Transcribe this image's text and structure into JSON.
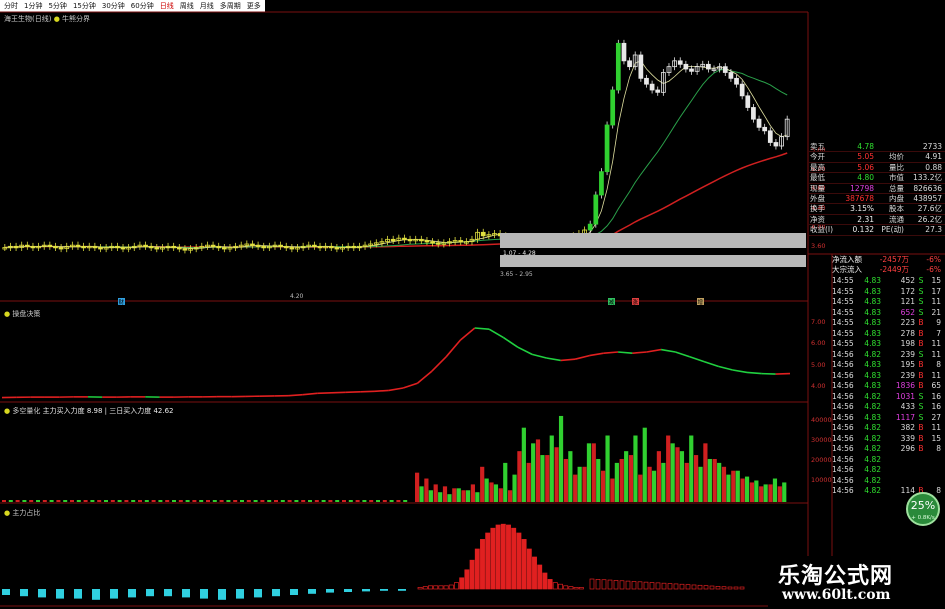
{
  "tabs": [
    "分时",
    "1分钟",
    "5分钟",
    "15分钟",
    "30分钟",
    "60分钟",
    "日线",
    "周线",
    "月线",
    "多周期",
    "更多"
  ],
  "active_tab": "日线",
  "panes": {
    "main_title": "海王生物(日线)",
    "main_indicator": "牛熊分界",
    "p2_title": "操盘决策",
    "p3_title": "多空量化",
    "p3_l1": "主力买入力度",
    "p3_v1": "8.98",
    "p3_l2": "三日买入力度",
    "p3_v2": "42.62",
    "p4_title": "主力占比"
  },
  "quote": [
    {
      "k": "卖五",
      "v": "4.78",
      "vc": "grn",
      "k2": "",
      "v2": "2733"
    },
    {
      "k": "今开",
      "v": "5.05",
      "vc": "red",
      "k2": "均价",
      "v2": "4.91"
    },
    {
      "k": "最高",
      "v": "5.06",
      "vc": "red",
      "k2": "量比",
      "v2": "0.88"
    },
    {
      "k": "最低",
      "v": "4.80",
      "vc": "grn",
      "k2": "市值",
      "v2": "133.2亿"
    },
    {
      "k": "现量",
      "v": "12798",
      "vc": "mag",
      "k2": "总量",
      "v2": "826636"
    },
    {
      "k": "外盘",
      "v": "387678",
      "vc": "red",
      "k2": "内盘",
      "v2": "438957"
    },
    {
      "k": "换手",
      "v": "3.15%",
      "vc": "wht",
      "k2": "股本",
      "v2": "27.6亿"
    },
    {
      "k": "净资",
      "v": "2.31",
      "vc": "wht",
      "k2": "流通",
      "v2": "26.2亿"
    },
    {
      "k": "收益(I)",
      "v": "0.132",
      "vc": "wht",
      "k2": "PE(动)",
      "v2": "27.3"
    }
  ],
  "flows": [
    {
      "k": "净流入额",
      "v": "-2457万",
      "p": "-6%"
    },
    {
      "k": "大宗流入",
      "v": "-2449万",
      "p": "-6%"
    }
  ],
  "ticks": [
    {
      "t": "14:55",
      "p": "4.83",
      "v": "452",
      "s": "S",
      "n": "15"
    },
    {
      "t": "14:55",
      "p": "4.83",
      "v": "172",
      "s": "S",
      "n": "17"
    },
    {
      "t": "14:55",
      "p": "4.83",
      "v": "121",
      "s": "S",
      "n": "11"
    },
    {
      "t": "14:55",
      "p": "4.83",
      "v": "652",
      "s": "S",
      "n": "21"
    },
    {
      "t": "14:55",
      "p": "4.83",
      "v": "223",
      "s": "B",
      "n": "9"
    },
    {
      "t": "14:55",
      "p": "4.83",
      "v": "278",
      "s": "B",
      "n": "7"
    },
    {
      "t": "14:55",
      "p": "4.83",
      "v": "198",
      "s": "B",
      "n": "11"
    },
    {
      "t": "14:56",
      "p": "4.82",
      "v": "239",
      "s": "S",
      "n": "11"
    },
    {
      "t": "14:56",
      "p": "4.83",
      "v": "195",
      "s": "B",
      "n": "8"
    },
    {
      "t": "14:56",
      "p": "4.83",
      "v": "239",
      "s": "B",
      "n": "11"
    },
    {
      "t": "14:56",
      "p": "4.83",
      "v": "1836",
      "s": "B",
      "n": "65"
    },
    {
      "t": "14:56",
      "p": "4.82",
      "v": "1031",
      "s": "S",
      "n": "16"
    },
    {
      "t": "14:56",
      "p": "4.82",
      "v": "433",
      "s": "S",
      "n": "16"
    },
    {
      "t": "14:56",
      "p": "4.83",
      "v": "1117",
      "s": "S",
      "n": "27"
    },
    {
      "t": "14:56",
      "p": "4.82",
      "v": "382",
      "s": "B",
      "n": "11"
    },
    {
      "t": "14:56",
      "p": "4.82",
      "v": "339",
      "s": "B",
      "n": "15"
    },
    {
      "t": "14:56",
      "p": "4.82",
      "v": "296",
      "s": "B",
      "n": "8"
    },
    {
      "t": "14:56",
      "p": "4.82",
      "v": "",
      "s": "",
      "n": ""
    },
    {
      "t": "14:56",
      "p": "4.82",
      "v": "",
      "s": "",
      "n": ""
    },
    {
      "t": "14:56",
      "p": "4.82",
      "v": "",
      "s": "",
      "n": ""
    },
    {
      "t": "14:56",
      "p": "4.82",
      "v": "114",
      "s": "B",
      "n": "8"
    }
  ],
  "axis_main": [
    "5.60",
    "5.20",
    "4.80",
    "4.40",
    "4.00",
    "3.60"
  ],
  "axis_p2": [
    "7.00",
    "6.00",
    "5.00",
    "4.00"
  ],
  "axis_p3": [
    "40000",
    "30000",
    "20000",
    "10000"
  ],
  "annotations": {
    "a1": "1.07 - 4.28",
    "a2": "3.65 - 2.95",
    "a3": "4.20"
  },
  "markers": [
    "财",
    "减",
    "涨",
    "增"
  ],
  "badge": {
    "pct": "25%",
    "speed": "+ 0.8K/s"
  },
  "watermark": {
    "title": "乐淘公式网",
    "url": "www.60lt.com"
  },
  "colors": {
    "up": "#ff3030",
    "down": "#30e030",
    "grid": "#7a1010",
    "cyan": "#30d0e0"
  },
  "chart_data": [
    {
      "type": "candlestick",
      "title": "海王生物(日线)",
      "note": "daily candles with moving averages; approximate prices read from right axis",
      "close": [
        3.95,
        3.96,
        3.95,
        3.97,
        3.96,
        3.95,
        3.96,
        3.97,
        3.96,
        3.95,
        3.94,
        3.96,
        3.97,
        3.96,
        3.95,
        3.96,
        3.95,
        3.94,
        3.95,
        3.96,
        3.95,
        3.94,
        3.95,
        3.96,
        3.97,
        3.96,
        3.95,
        3.94,
        3.95,
        3.96,
        3.95,
        3.94,
        3.93,
        3.94,
        3.95,
        3.96,
        3.97,
        3.96,
        3.95,
        3.94,
        3.95,
        3.96,
        3.97,
        3.98,
        3.97,
        3.96,
        3.95,
        3.96,
        3.97,
        3.96,
        3.95,
        3.94,
        3.95,
        3.96,
        3.97,
        3.96,
        3.95,
        3.96,
        3.95,
        3.94,
        3.95,
        3.96,
        3.95,
        3.96,
        3.97,
        3.98,
        3.99,
        4.0,
        4.02,
        4.01,
        4.03,
        4.02,
        4.01,
        4.02,
        4.01,
        4.0,
        3.99,
        3.98,
        3.99,
        4.0,
        4.01,
        4.0,
        4.0,
        4.02,
        4.08,
        4.05,
        4.06,
        4.07,
        4.05,
        4.04,
        4.04,
        4.03,
        4.03,
        4.02,
        4.03,
        4.02,
        4.01,
        4.01,
        4.0,
        4.02,
        4.03,
        4.05,
        4.07,
        4.1,
        4.15,
        4.4,
        4.6,
        5.0,
        5.3,
        5.7,
        5.55,
        5.5,
        5.6,
        5.4,
        5.35,
        5.3,
        5.28,
        5.45,
        5.5,
        5.55,
        5.52,
        5.48,
        5.46,
        5.5,
        5.52,
        5.48,
        5.48,
        5.5,
        5.45,
        5.4,
        5.35,
        5.25,
        5.15,
        5.05,
        4.98,
        4.95,
        4.85,
        4.82,
        4.9,
        5.05
      ]
    },
    {
      "type": "line",
      "title": "操盘决策",
      "ylim": [
        4.0,
        7.5
      ],
      "values": [
        4.1,
        4.11,
        4.12,
        4.12,
        4.12,
        4.13,
        4.13,
        4.12,
        4.12,
        4.13,
        4.13,
        4.12,
        4.12,
        4.13,
        4.13,
        4.14,
        4.14,
        4.15,
        4.16,
        4.17,
        4.18,
        4.22,
        4.28,
        4.3,
        4.32,
        4.34,
        4.36,
        4.4,
        4.5,
        4.7,
        5.2,
        5.8,
        6.5,
        7.0,
        6.95,
        6.6,
        6.2,
        5.9,
        5.75,
        5.65,
        5.7,
        5.85,
        5.95,
        6.0,
        5.95,
        6.0,
        6.1,
        6.0,
        5.8,
        5.6,
        5.4,
        5.25,
        5.15,
        5.1,
        5.08,
        5.1
      ]
    },
    {
      "type": "bar",
      "title": "多空量化",
      "ylim": [
        0,
        45000
      ],
      "series": [
        {
          "name": "主力买入力度",
          "values": [
            15000,
            12000,
            9000,
            8000,
            7000,
            6000,
            9000,
            18000,
            10000,
            7000,
            6000,
            26000,
            20000,
            32000,
            24000,
            28000,
            22000,
            14000,
            18000,
            30000,
            16000,
            12000,
            22000,
            24000,
            14000,
            18000,
            26000,
            34000,
            28000,
            20000,
            24000,
            30000,
            22000,
            18000,
            16000,
            12000,
            10000,
            8000,
            9000,
            8000
          ]
        },
        {
          "name": "三日买入力度",
          "values": [
            8000,
            6000,
            5000,
            4000,
            7000,
            6000,
            5000,
            12000,
            9000,
            20000,
            14000,
            38000,
            30000,
            24000,
            34000,
            44000,
            26000,
            18000,
            30000,
            22000,
            34000,
            20000,
            26000,
            34000,
            38000,
            16000,
            20000,
            30000,
            26000,
            34000,
            18000,
            22000,
            20000,
            14000,
            16000,
            13000,
            11000,
            9000,
            12000,
            10000
          ]
        }
      ]
    },
    {
      "type": "bar",
      "title": "主力占比",
      "values_pos": [
        2,
        3,
        4,
        4,
        4,
        4,
        5,
        8,
        14,
        24,
        36,
        50,
        62,
        70,
        76,
        80,
        81,
        80,
        76,
        70,
        62,
        50,
        40,
        30,
        20,
        12,
        8,
        6,
        4,
        3,
        2,
        2
      ],
      "values_neg": [
        10,
        12,
        14,
        16,
        16,
        18,
        16,
        14,
        12,
        12,
        14,
        16,
        18,
        16,
        14,
        12,
        10,
        8,
        6,
        5,
        4,
        3,
        3
      ]
    }
  ]
}
